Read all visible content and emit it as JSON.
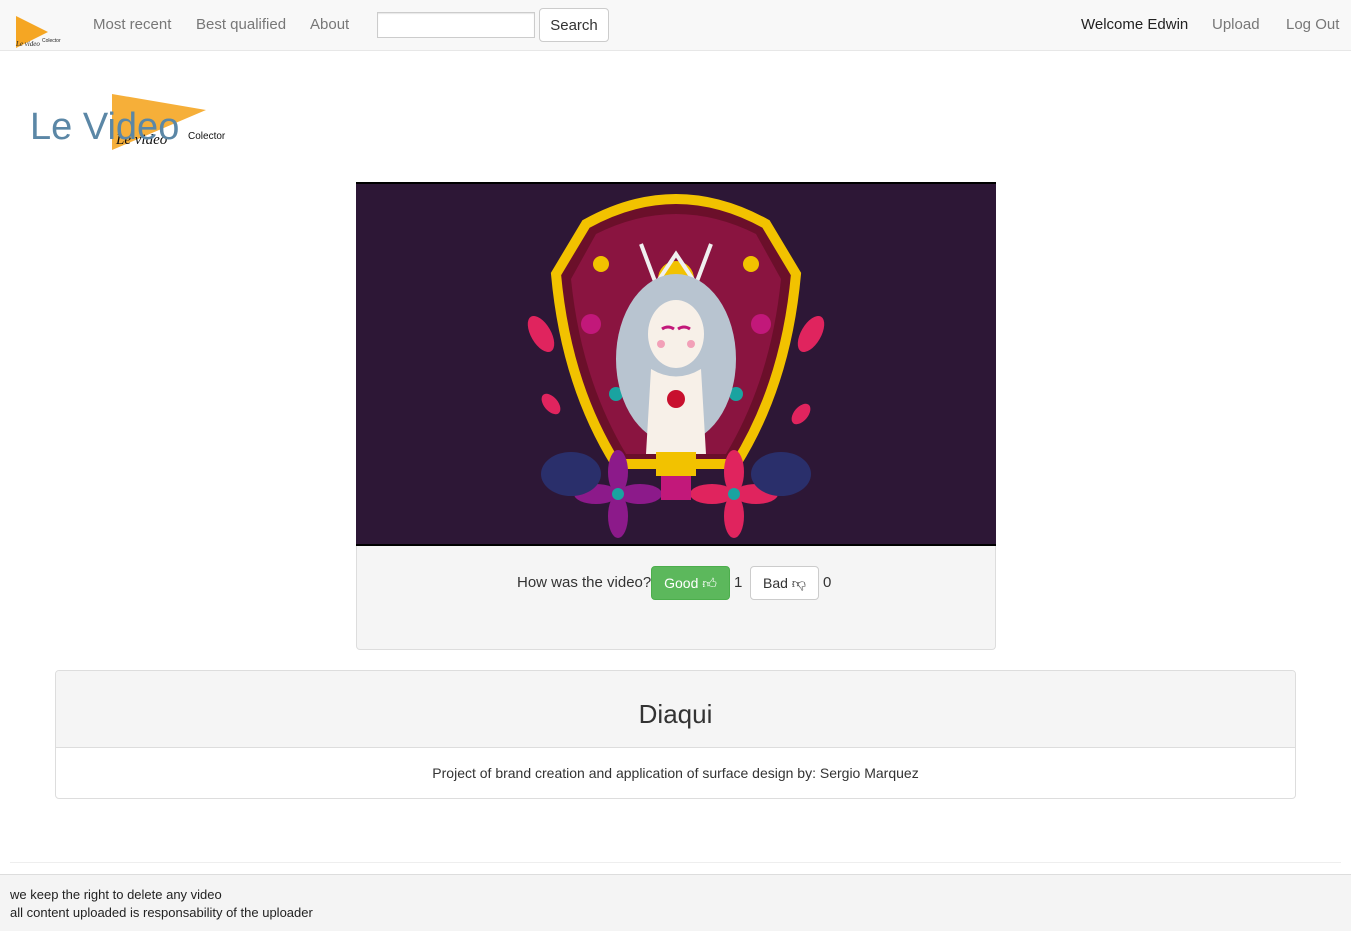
{
  "nav": {
    "logo_text": "Le video Colector",
    "most_recent": "Most recent",
    "best_qualified": "Best qualified",
    "about": "About",
    "search_value": "",
    "search_button": "Search",
    "welcome": "Welcome Edwin",
    "upload": "Upload",
    "logout": "Log Out"
  },
  "brand": {
    "title": "Le Video",
    "logo_script": "Le video",
    "logo_small": "Colector",
    "flag_color": "#f5a623"
  },
  "video": {
    "background_color": "#2d1736"
  },
  "rating": {
    "question": "How was the video?",
    "good_label": "Good",
    "good_icon": "thumbs-up-icon",
    "good_count": "1",
    "bad_label": "Bad",
    "bad_icon": "thumbs-down-icon",
    "bad_count": "0",
    "good_color": "#5cb85c"
  },
  "video_info": {
    "title": "Diaqui",
    "description": "Project of brand creation and application of surface design by: Sergio Marquez"
  },
  "footer": {
    "line1": "we keep the right to delete any video",
    "line2": "all content uploaded is responsability of the uploader"
  }
}
